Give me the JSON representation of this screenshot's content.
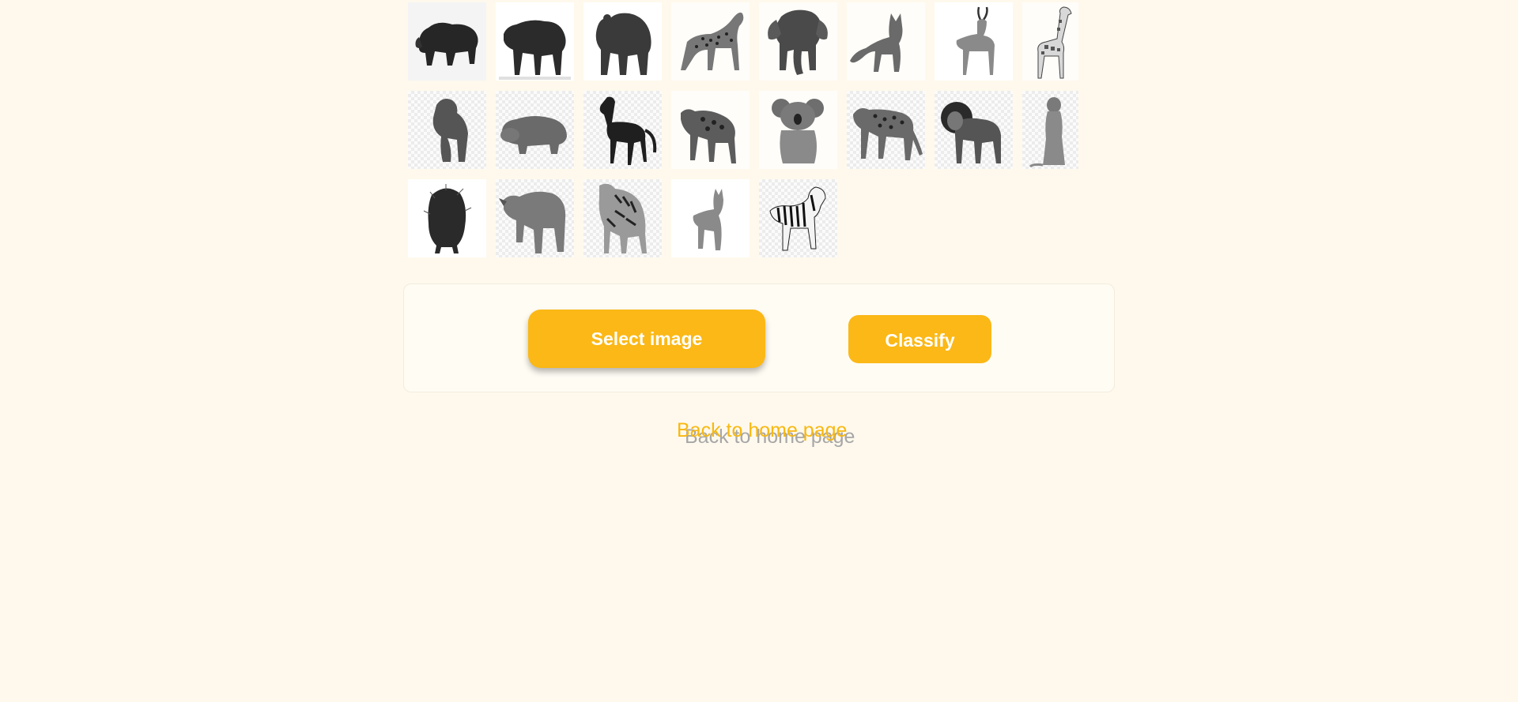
{
  "gallery": {
    "rows": [
      [
        {
          "name": "bison",
          "icon": "bison-image"
        },
        {
          "name": "boar",
          "icon": "boar-image"
        },
        {
          "name": "bear",
          "icon": "bear-image"
        },
        {
          "name": "cheetah",
          "icon": "cheetah-image"
        },
        {
          "name": "elephant",
          "icon": "elephant-image"
        },
        {
          "name": "fox",
          "icon": "fox-image"
        },
        {
          "name": "gazelle",
          "icon": "gazelle-image"
        },
        {
          "name": "giraffe",
          "icon": "giraffe-image"
        }
      ],
      [
        {
          "name": "gorilla",
          "icon": "gorilla-image"
        },
        {
          "name": "hippopotamus",
          "icon": "hippopotamus-image"
        },
        {
          "name": "horse",
          "icon": "horse-image"
        },
        {
          "name": "hyena",
          "icon": "hyena-image"
        },
        {
          "name": "koala",
          "icon": "koala-image"
        },
        {
          "name": "leopard",
          "icon": "leopard-image"
        },
        {
          "name": "lion",
          "icon": "lion-image"
        },
        {
          "name": "meerkat",
          "icon": "meerkat-image"
        }
      ],
      [
        {
          "name": "porcupine",
          "icon": "porcupine-image"
        },
        {
          "name": "rhinoceros",
          "icon": "rhinoceros-image"
        },
        {
          "name": "tiger",
          "icon": "tiger-image"
        },
        {
          "name": "wolf",
          "icon": "wolf-image"
        },
        {
          "name": "zebra",
          "icon": "zebra-image"
        }
      ]
    ]
  },
  "actions": {
    "select_label": "Select image",
    "classify_label": "Classify"
  },
  "links": {
    "home_label": "Back to home page"
  },
  "colors": {
    "background": "#fff9ed",
    "accent": "#fbb816",
    "button_text": "#ffffff",
    "link": "#f8b810",
    "link_shadow": "#a7a7a7"
  }
}
